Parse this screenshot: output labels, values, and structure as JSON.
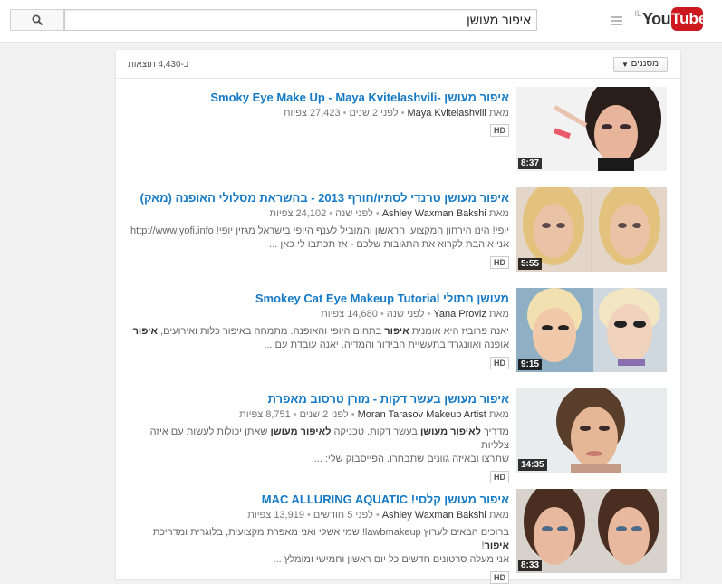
{
  "header": {
    "logo_you": "You",
    "logo_tube": "Tube",
    "country": "IL",
    "search_value": "איפור מעושן"
  },
  "results_bar": {
    "filters_label": "מסננים",
    "count": "כ-4,430 תוצאות"
  },
  "results": [
    {
      "title": "איפור מעושן -Smoky Eye Make Up - Maya Kvitelashvili",
      "by": "מאת",
      "channel": "Maya Kvitelashvili",
      "age": "לפני 2 שנים",
      "views": "27,423 צפיות",
      "desc1": "",
      "desc2": "",
      "desc3": "",
      "badge": "HD",
      "duration": "8:37"
    },
    {
      "title": "איפור מעושן טרנדי לסתיו/חורף 2013 - בהשראת מסלולי האופנה (מאק)",
      "by": "מאת",
      "channel": "Ashley Waxman Bakshi",
      "age": "לפני שנה",
      "views": "24,102 צפיות",
      "desc1": "יופי! הינו הירחון המקצועי הראשון והמוביל לענף היופי בישראל מגזין יופי! http://www.yofi.info",
      "desc2": "אני אוהבת לקרוא את התגובות שלכם - אז תכתבו לי כאן ...",
      "desc3": "",
      "badge": "HD",
      "duration": "5:55"
    },
    {
      "title": "מעושן חתולי Smokey Cat Eye Makeup Tutorial",
      "by": "מאת",
      "channel": "Yana Proviz",
      "age": "לפני שנה",
      "views": "14,680 צפיות",
      "desc1": "יאנה פרוביז היא אומנית ",
      "desc1b": "איפור",
      "desc1c": " בתחום היופי והאופנה. מתמחה באיפור כלות ואירועים, ",
      "desc1d": "איפור",
      "desc2": "אופנה ואוונגרד בתעשיית הבידור והמדיה. יאנה עובדת עם ...",
      "badge": "HD",
      "duration": "9:15"
    },
    {
      "title": "איפור מעושן בעשר דקות - מורן טרסוב מאפרת",
      "by": "מאת",
      "channel": "Moran Tarasov Makeup Artist",
      "age": "לפני 2 שנים",
      "views": "8,751 צפיות",
      "desc1": "מדריך ",
      "desc1b": "לאיפור מעושן",
      "desc1c": " בעשר דקות. טכניקה ",
      "desc1d": "לאיפור מעושן",
      "desc1e": " שאתן יכולות לעשות עם איזה צלליות",
      "desc2": "שתרצו ובאיזה גוונים שתבחרו. הפייסבוק שלי: ...",
      "badge": "HD",
      "duration": "14:35"
    },
    {
      "title": "איפור מעושן קלסי! MAC ALLURING AQUATIC",
      "by": "מאת",
      "channel": "Ashley Waxman Bakshi",
      "age": "לפני 5 חודשים",
      "views": "13,919 צפיות",
      "desc1": "ברוכים הבאים לערוץ lawbmakeup! שמי אשלי ואני מאפרת מקצועית, בלוגרית ומדריכת ",
      "desc1b": "איפור",
      "desc1c": "!",
      "desc2": "אני מעלה סרטונים חדשים כל יום ראשון וחמישי ומומלץ ...",
      "badge": "HD",
      "duration": "8:33"
    }
  ],
  "colors": {
    "link": "#167ac6",
    "brand_red": "#cc181e"
  }
}
